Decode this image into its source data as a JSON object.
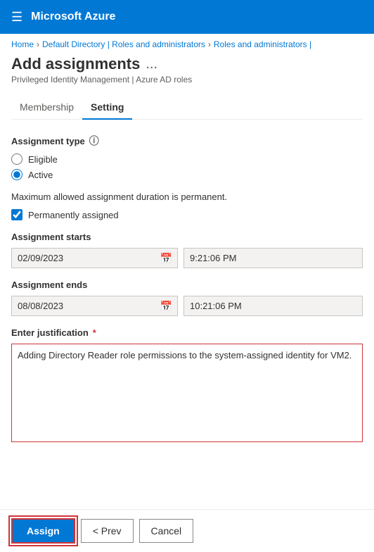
{
  "topNav": {
    "appTitle": "Microsoft Azure"
  },
  "breadcrumb": {
    "home": "Home",
    "defaultDirectory": "Default Directory | Roles and administrators",
    "rolesAndAdmins": "Roles and administrators |"
  },
  "pageHeader": {
    "title": "Add assignments",
    "subtitle": "Privileged Identity Management | Azure AD roles",
    "moreLabel": "..."
  },
  "tabs": [
    {
      "id": "membership",
      "label": "Membership",
      "active": false
    },
    {
      "id": "setting",
      "label": "Setting",
      "active": true
    }
  ],
  "form": {
    "assignmentTypeLabel": "Assignment type",
    "radioOptions": [
      {
        "id": "eligible",
        "label": "Eligible",
        "checked": false
      },
      {
        "id": "active",
        "label": "Active",
        "checked": true
      }
    ],
    "infoMessage": "Maximum allowed assignment duration is permanent.",
    "checkboxLabel": "Permanently assigned",
    "checkboxChecked": true,
    "assignmentStartsLabel": "Assignment starts",
    "startDate": "02/09/2023",
    "startTime": "9:21:06 PM",
    "assignmentEndsLabel": "Assignment ends",
    "endDate": "08/08/2023",
    "endTime": "10:21:06 PM",
    "justificationLabel": "Enter justification",
    "justificationRequired": true,
    "justificationValue": "Adding Directory Reader role permissions to the system-assigned identity for VM2."
  },
  "footer": {
    "assignLabel": "Assign",
    "prevLabel": "< Prev",
    "cancelLabel": "Cancel"
  }
}
